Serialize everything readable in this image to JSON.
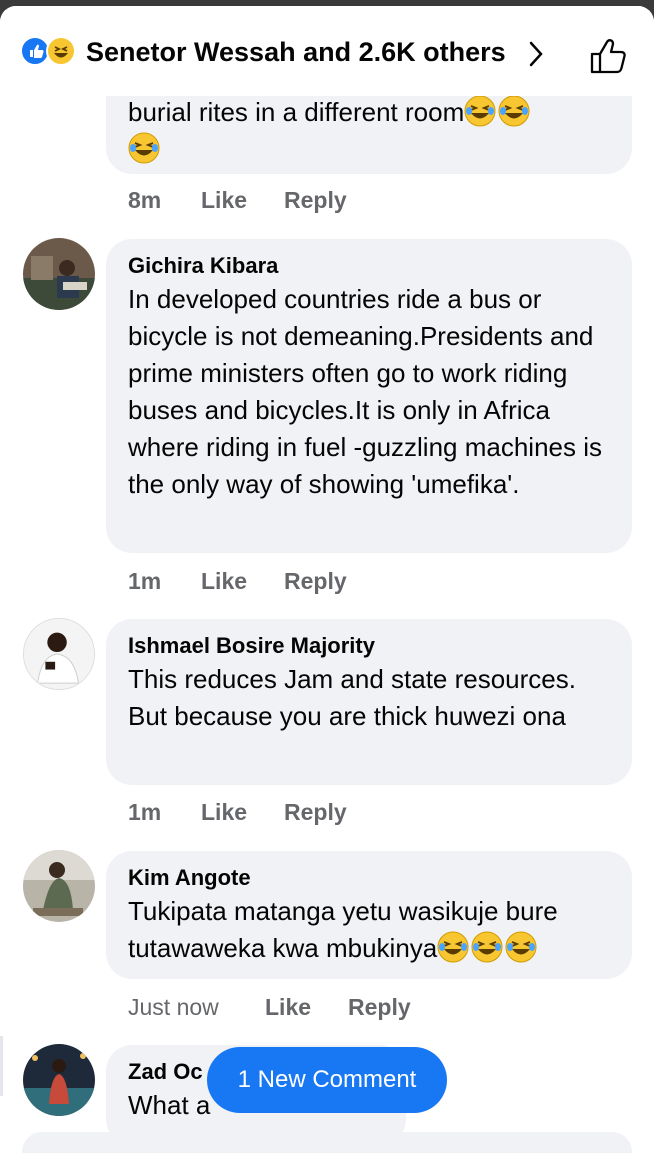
{
  "header": {
    "title": "Senetor Wessah and 2.6K others",
    "reaction_icons": [
      "like-reaction-icon",
      "haha-reaction-icon"
    ]
  },
  "comments": [
    {
      "author": "",
      "text": "burial rites in a different room",
      "emoji_count": 3,
      "time": "8m",
      "like": "Like",
      "reply": "Reply"
    },
    {
      "author": "Gichira Kibara",
      "text": "In developed countries ride a bus or bicycle is not demeaning.Presidents and prime ministers often go to work riding buses and bicycles.It is  only in Africa where riding in fuel -guzzling machines is the only way of showing 'umefika'.",
      "time": "1m",
      "like": "Like",
      "reply": "Reply"
    },
    {
      "author": "Ishmael Bosire Majority",
      "text": "This reduces Jam and state resources. But because you are thick huwezi ona",
      "time": "1m",
      "like": "Like",
      "reply": "Reply"
    },
    {
      "author": "Kim Angote",
      "text": "Tukipata matanga yetu wasikuje bure tutawaweka kwa mbukinya",
      "emoji_count": 3,
      "time": "Just now",
      "like": "Like",
      "reply": "Reply"
    },
    {
      "author": "Zad Oc",
      "text": "What a",
      "time": "",
      "like": "",
      "reply": ""
    }
  ],
  "new_comment_label": "1 New Comment",
  "colors": {
    "accent": "#1877f2",
    "bubble": "#f0f2f5",
    "meta_text": "#65676b",
    "haha_yellow": "#f7c631"
  }
}
